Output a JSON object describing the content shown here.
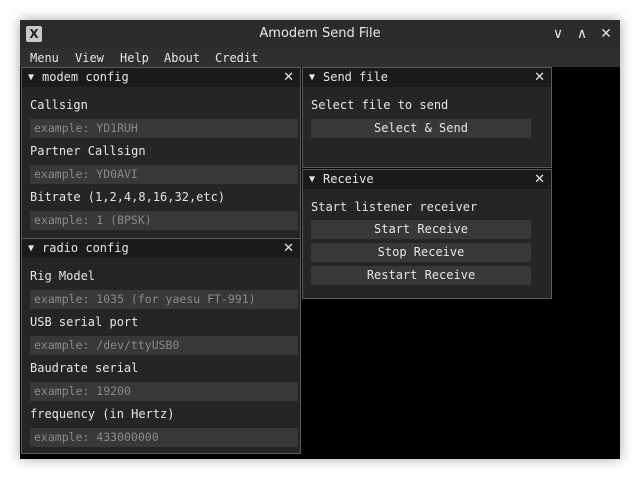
{
  "window": {
    "title": "Amodem Send File",
    "icon_glyph": "X",
    "controls": {
      "minimize": "∨",
      "maximize": "∧",
      "close": "✕"
    }
  },
  "menubar": {
    "items": [
      "Menu",
      "View",
      "Help",
      "About",
      "Credit"
    ]
  },
  "modem_config": {
    "arrow": "▼",
    "title": "modem config",
    "close": "✕",
    "callsign_label": "Callsign",
    "callsign_placeholder": "example: YD1RUH",
    "partner_label": "Partner Callsign",
    "partner_placeholder": "example: YD0AVI",
    "bitrate_label": "Bitrate (1,2,4,8,16,32,etc)",
    "bitrate_placeholder": "example: 1 (BPSK)"
  },
  "radio_config": {
    "arrow": "▼",
    "title": "radio config",
    "close": "✕",
    "rig_label": "Rig Model",
    "rig_placeholder": "example: 1035 (for yaesu FT-991)",
    "usb_label": "USB serial port",
    "usb_placeholder": "example: /dev/ttyUSB0",
    "baud_label": "Baudrate serial",
    "baud_placeholder": "example: 19200",
    "freq_label": "frequency (in Hertz)",
    "freq_placeholder": "example: 433000000"
  },
  "send_file": {
    "arrow": "▼",
    "title": "Send file",
    "close": "✕",
    "prompt": "Select file to send",
    "button": "Select & Send"
  },
  "receive": {
    "arrow": "▼",
    "title": "Receive",
    "close": "✕",
    "prompt": "Start listener receiver",
    "start_button": "Start Receive",
    "stop_button": "Stop Receive",
    "restart_button": "Restart Receive"
  },
  "colors": {
    "panel_bg": "#252525",
    "panel_header": "#1a1a1a",
    "input_bg": "#383838",
    "placeholder_text": "#8a8a8a",
    "text": "#e6e6e6",
    "titlebar": "#2b2b2b",
    "viewport": "#000000"
  }
}
